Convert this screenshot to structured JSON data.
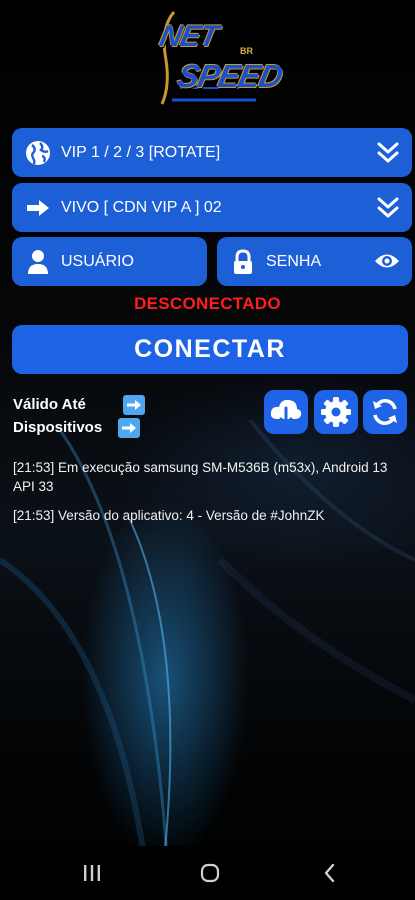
{
  "app": {
    "logo_text_top": "NET",
    "logo_text_bottom": "SPEED",
    "logo_suffix": "BR"
  },
  "form": {
    "server": {
      "label": "VIP 1 / 2 / 3 [ROTATE]",
      "icon": "globe-icon"
    },
    "network": {
      "label": "VIVO [ CDN VIP A ] 02",
      "icon": "arrow-right-icon"
    },
    "username": {
      "placeholder": "USUÁRIO",
      "icon": "user-icon"
    },
    "password": {
      "placeholder": "SENHA",
      "icon": "lock-icon",
      "toggle_icon": "eye-icon"
    }
  },
  "status": {
    "text": "DESCONECTADO",
    "color": "#ff1d1d"
  },
  "connect_button": {
    "label": "CONECTAR"
  },
  "info": {
    "valid_until_label": "Válido Até",
    "devices_label": "Dispositivos"
  },
  "actions": [
    {
      "name": "download-icon"
    },
    {
      "name": "settings-icon"
    },
    {
      "name": "refresh-icon"
    }
  ],
  "log": [
    "[21:53] Em execução samsung SM-M536B (m53x), Android 13 API 33",
    "[21:53] Versão do aplicativo: 4 - Versão de #JohnZK"
  ],
  "colors": {
    "accent": "#1d5fd6",
    "button": "#1e62e6",
    "arrow": "#4ea7ef",
    "logo_gold": "#c79a28"
  }
}
